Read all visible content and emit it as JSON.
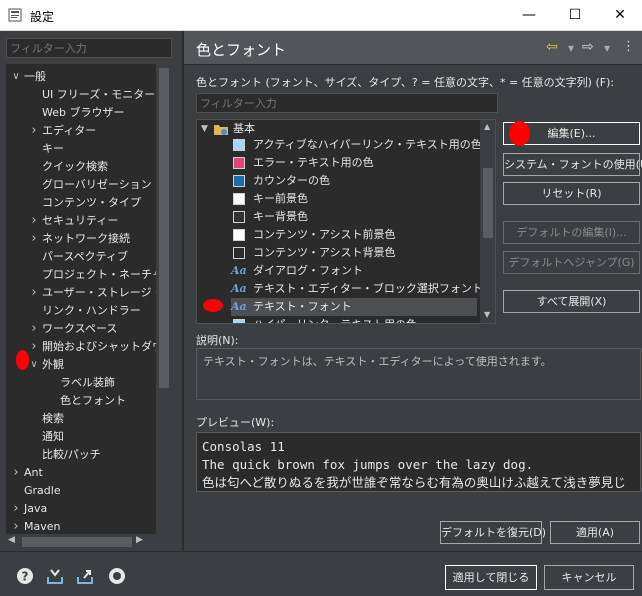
{
  "window": {
    "title": "設定"
  },
  "left": {
    "filter_placeholder": "フィルター入力",
    "tree": [
      {
        "label": "一般",
        "depth": 0,
        "arrow": "down"
      },
      {
        "label": "UI フリーズ・モニター",
        "depth": 1,
        "arrow": ""
      },
      {
        "label": "Web ブラウザー",
        "depth": 1,
        "arrow": ""
      },
      {
        "label": "エディター",
        "depth": 1,
        "arrow": "right"
      },
      {
        "label": "キー",
        "depth": 1,
        "arrow": ""
      },
      {
        "label": "クイック検索",
        "depth": 1,
        "arrow": ""
      },
      {
        "label": "グローバリゼーション",
        "depth": 1,
        "arrow": ""
      },
      {
        "label": "コンテンツ・タイプ",
        "depth": 1,
        "arrow": ""
      },
      {
        "label": "セキュリティー",
        "depth": 1,
        "arrow": "right"
      },
      {
        "label": "ネットワーク接続",
        "depth": 1,
        "arrow": "right"
      },
      {
        "label": "パースペクティブ",
        "depth": 1,
        "arrow": ""
      },
      {
        "label": "プロジェクト・ネーチャー",
        "depth": 1,
        "arrow": ""
      },
      {
        "label": "ユーザー・ストレージ・サービス",
        "depth": 1,
        "arrow": "right"
      },
      {
        "label": "リンク・ハンドラー",
        "depth": 1,
        "arrow": ""
      },
      {
        "label": "ワークスペース",
        "depth": 1,
        "arrow": "right"
      },
      {
        "label": "開始およびシャットダウン",
        "depth": 1,
        "arrow": "right"
      },
      {
        "label": "外観",
        "depth": 1,
        "arrow": "down"
      },
      {
        "label": "ラベル装飾",
        "depth": 2,
        "arrow": ""
      },
      {
        "label": "色とフォント",
        "depth": 2,
        "arrow": ""
      },
      {
        "label": "検索",
        "depth": 1,
        "arrow": ""
      },
      {
        "label": "通知",
        "depth": 1,
        "arrow": ""
      },
      {
        "label": "比較/パッチ",
        "depth": 1,
        "arrow": ""
      },
      {
        "label": "Ant",
        "depth": 0,
        "arrow": "right"
      },
      {
        "label": "Gradle",
        "depth": 0,
        "arrow": ""
      },
      {
        "label": "Java",
        "depth": 0,
        "arrow": "right"
      },
      {
        "label": "Maven",
        "depth": 0,
        "arrow": "right"
      }
    ]
  },
  "right": {
    "title": "色とフォント",
    "description": "色とフォント (フォント、サイズ、タイプ、? = 任意の文字、* = 任意の文字列) (F):",
    "filter_placeholder": "フィルター入力",
    "category": "基本",
    "items": [
      {
        "label": "アクティブなハイパーリンク・テキスト用の色",
        "kind": "color",
        "color": "#a6d4f2"
      },
      {
        "label": "エラー・テキスト用の色",
        "kind": "color",
        "color": "#e0457b"
      },
      {
        "label": "カウンターの色",
        "kind": "color",
        "color": "#1b6fa8"
      },
      {
        "label": "キー前景色",
        "kind": "color",
        "color": "#ffffff"
      },
      {
        "label": "キー背景色",
        "kind": "color",
        "color": "#333333"
      },
      {
        "label": "コンテンツ・アシスト前景色",
        "kind": "color",
        "color": "#ffffff"
      },
      {
        "label": "コンテンツ・アシスト背景色",
        "kind": "color",
        "color": "#2b2b2b"
      },
      {
        "label": "ダイアログ・フォント",
        "kind": "font",
        "glyph": "Aa"
      },
      {
        "label": "テキスト・エディター・ブロック選択フォント",
        "kind": "font",
        "glyph": "Aa"
      },
      {
        "label": "テキスト・フォント",
        "kind": "font",
        "glyph": "Aa"
      },
      {
        "label": "ハイパーリンク・テキスト用の色",
        "kind": "color",
        "color": "#a6d4f2"
      }
    ],
    "buttons": {
      "edit": "編集(E)...",
      "use_system_font": "システム・フォントの使用(U)",
      "reset": "リセット(R)",
      "edit_default": "デフォルトの編集(I)...",
      "go_to_default": "デフォルトへジャンプ(G)",
      "expand_all": "すべて展開(X)",
      "restore_defaults": "デフォルトを復元(D)",
      "apply": "適用(A)"
    },
    "description_label": "説明(N):",
    "description_text": "テキスト・フォントは、テキスト・エディターによって使用されます。",
    "preview_label": "プレビュー(W):",
    "preview_lines": [
      "Consolas 11",
      "The quick brown fox jumps over the lazy dog.",
      "色は匂へど散りぬるを我が世誰ぞ常ならむ有為の奥山けふ越えて浅き夢見じ"
    ]
  },
  "footer": {
    "apply_close": "適用して閉じる",
    "cancel": "キャンセル"
  },
  "colors": {
    "accent_marker": "#ff0000",
    "background": "#3c3f41",
    "field": "#2b2b2b"
  }
}
